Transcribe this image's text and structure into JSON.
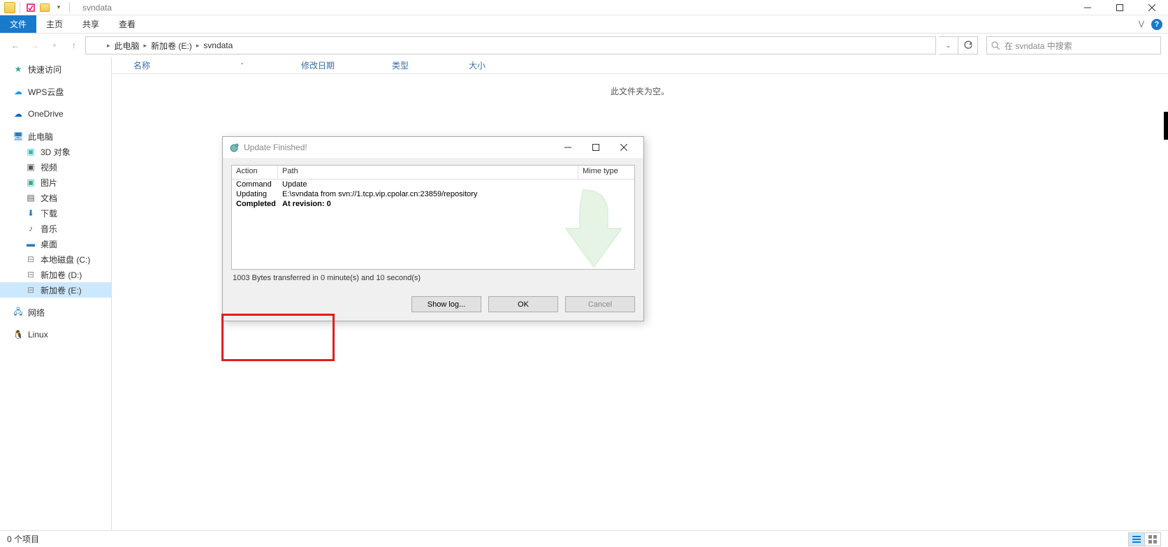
{
  "titlebar": {
    "title": "svndata"
  },
  "ribbon": {
    "file": "文件",
    "tabs": [
      "主页",
      "共享",
      "查看"
    ]
  },
  "breadcrumb": {
    "segments": [
      "此电脑",
      "新加卷 (E:)",
      "svndata"
    ]
  },
  "search": {
    "placeholder": "在 svndata 中搜索"
  },
  "nav": {
    "quick": "快速访问",
    "wps": "WPS云盘",
    "onedrive": "OneDrive",
    "thispc": "此电脑",
    "thispc_children": [
      "3D 对象",
      "视频",
      "图片",
      "文档",
      "下载",
      "音乐",
      "桌面",
      "本地磁盘 (C:)",
      "新加卷 (D:)",
      "新加卷 (E:)"
    ],
    "network": "网络",
    "linux": "Linux"
  },
  "columns": {
    "name": "名称",
    "modified": "修改日期",
    "type": "类型",
    "size": "大小"
  },
  "empty": "此文件夹为空。",
  "status": {
    "items": "0 个项目"
  },
  "dialog": {
    "title": "Update Finished!",
    "headers": {
      "action": "Action",
      "path": "Path",
      "mime": "Mime type"
    },
    "rows": [
      {
        "action": "Command",
        "path": "Update"
      },
      {
        "action": "Updating",
        "path": "E:\\svndata from svn://1.tcp.vip.cpolar.cn:23859/repository"
      },
      {
        "action": "Completed",
        "path": "At revision: 0",
        "bold": true
      }
    ],
    "transfer": "1003 Bytes transferred in 0 minute(s) and 10 second(s)",
    "btn_showlog": "Show log...",
    "btn_ok": "OK",
    "btn_cancel": "Cancel"
  }
}
